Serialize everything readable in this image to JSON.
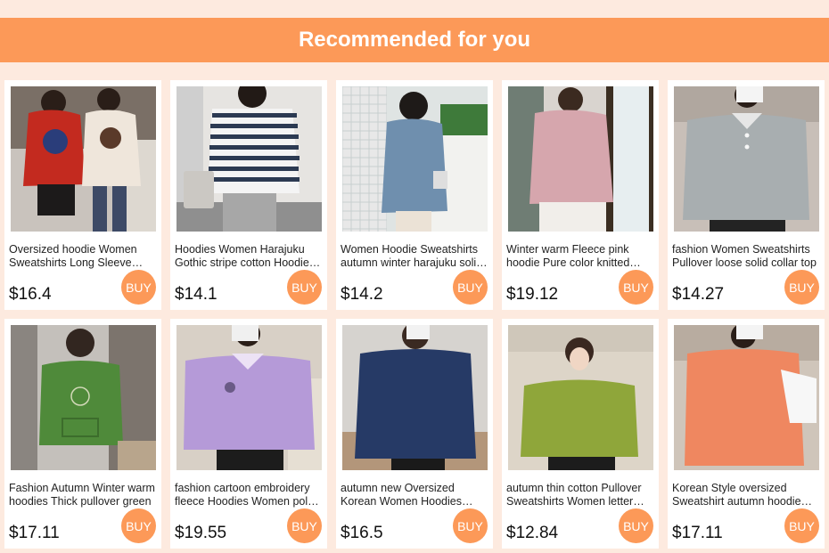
{
  "header": {
    "title": "Recommended for you"
  },
  "colors": {
    "accent": "#fc9958",
    "background": "#fdeadf",
    "card": "#ffffff"
  },
  "buy_label": "BUY",
  "products": [
    {
      "title": "Oversized hoodie Women Sweatshirts Long Sleeve Hardrock Printed Pullover",
      "price": "$16.4"
    },
    {
      "title": "Hoodies Women Harajuku Gothic stripe cotton Hoodie sweatshirt",
      "price": "$14.1"
    },
    {
      "title": "Women Hoodie Sweatshirts autumn winter harajuku solid pullover",
      "price": "$14.2"
    },
    {
      "title": "Winter warm Fleece pink hoodie Pure color knitted sweatshirt",
      "price": "$19.12"
    },
    {
      "title": "fashion Women Sweatshirts Pullover loose solid collar top",
      "price": "$14.27"
    },
    {
      "title": "Fashion Autumn Winter warm hoodies Thick pullover green",
      "price": "$17.11"
    },
    {
      "title": "fashion cartoon embroidery fleece Hoodies Women polo collar",
      "price": "$19.55"
    },
    {
      "title": "autumn new Oversized Korean Women Hoodies navy pullover",
      "price": "$16.5"
    },
    {
      "title": "autumn thin cotton Pullover Sweatshirts Women letter print",
      "price": "$12.84"
    },
    {
      "title": "Korean Style oversized Sweatshirt autumn hoodie orange",
      "price": "$17.11"
    }
  ]
}
